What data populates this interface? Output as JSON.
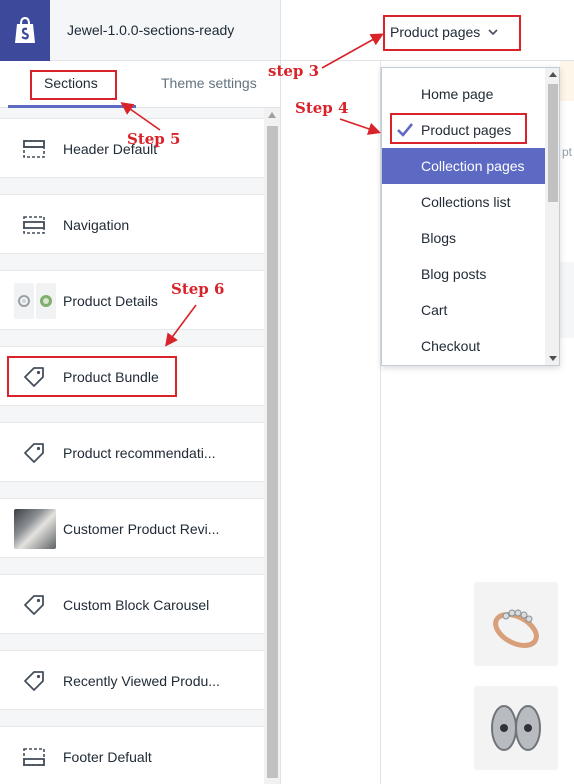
{
  "store": {
    "name": "Jewel-1.0.0-sections-ready",
    "logo_icon": "shopify-bag-icon"
  },
  "tabs": [
    {
      "label": "Sections",
      "active": true
    },
    {
      "label": "Theme settings",
      "active": false
    }
  ],
  "sections": [
    {
      "label": "Header Default",
      "icon": "header-layout-icon"
    },
    {
      "label": "Navigation",
      "icon": "navigation-layout-icon"
    },
    {
      "label": "Product Details",
      "icon": "product-thumbnails"
    },
    {
      "label": "Product Bundle",
      "icon": "tag-icon"
    },
    {
      "label": "Product recommendati...",
      "icon": "tag-icon"
    },
    {
      "label": "Customer Product Revi...",
      "icon": "photo-thumbnail"
    },
    {
      "label": "Custom Block Carousel",
      "icon": "tag-icon"
    },
    {
      "label": "Recently Viewed Produ...",
      "icon": "tag-icon"
    },
    {
      "label": "Footer Defualt",
      "icon": "footer-layout-icon"
    }
  ],
  "page_selector": {
    "label": "Product pages",
    "icon": "chevron-down-icon"
  },
  "dropdown": {
    "items": [
      {
        "label": "Home page",
        "checked": false,
        "highlighted": false
      },
      {
        "label": "Product pages",
        "checked": true,
        "highlighted": false
      },
      {
        "label": "Collection pages",
        "checked": false,
        "highlighted": true
      },
      {
        "label": "Collections list",
        "checked": false,
        "highlighted": false
      },
      {
        "label": "Blogs",
        "checked": false,
        "highlighted": false
      },
      {
        "label": "Blog posts",
        "checked": false,
        "highlighted": false
      },
      {
        "label": "Cart",
        "checked": false,
        "highlighted": false
      },
      {
        "label": "Checkout",
        "checked": false,
        "highlighted": false
      }
    ]
  },
  "preview": {
    "partial_text": "pt"
  },
  "annotations": {
    "color": "#d8232a",
    "step3": "step 3",
    "step4": "Step 4",
    "step5": "Step 5",
    "step6": "Step 6"
  },
  "colors": {
    "accent": "#5c6ac4",
    "logo_bg": "#3d4a9b",
    "annotation": "#d8232a"
  }
}
